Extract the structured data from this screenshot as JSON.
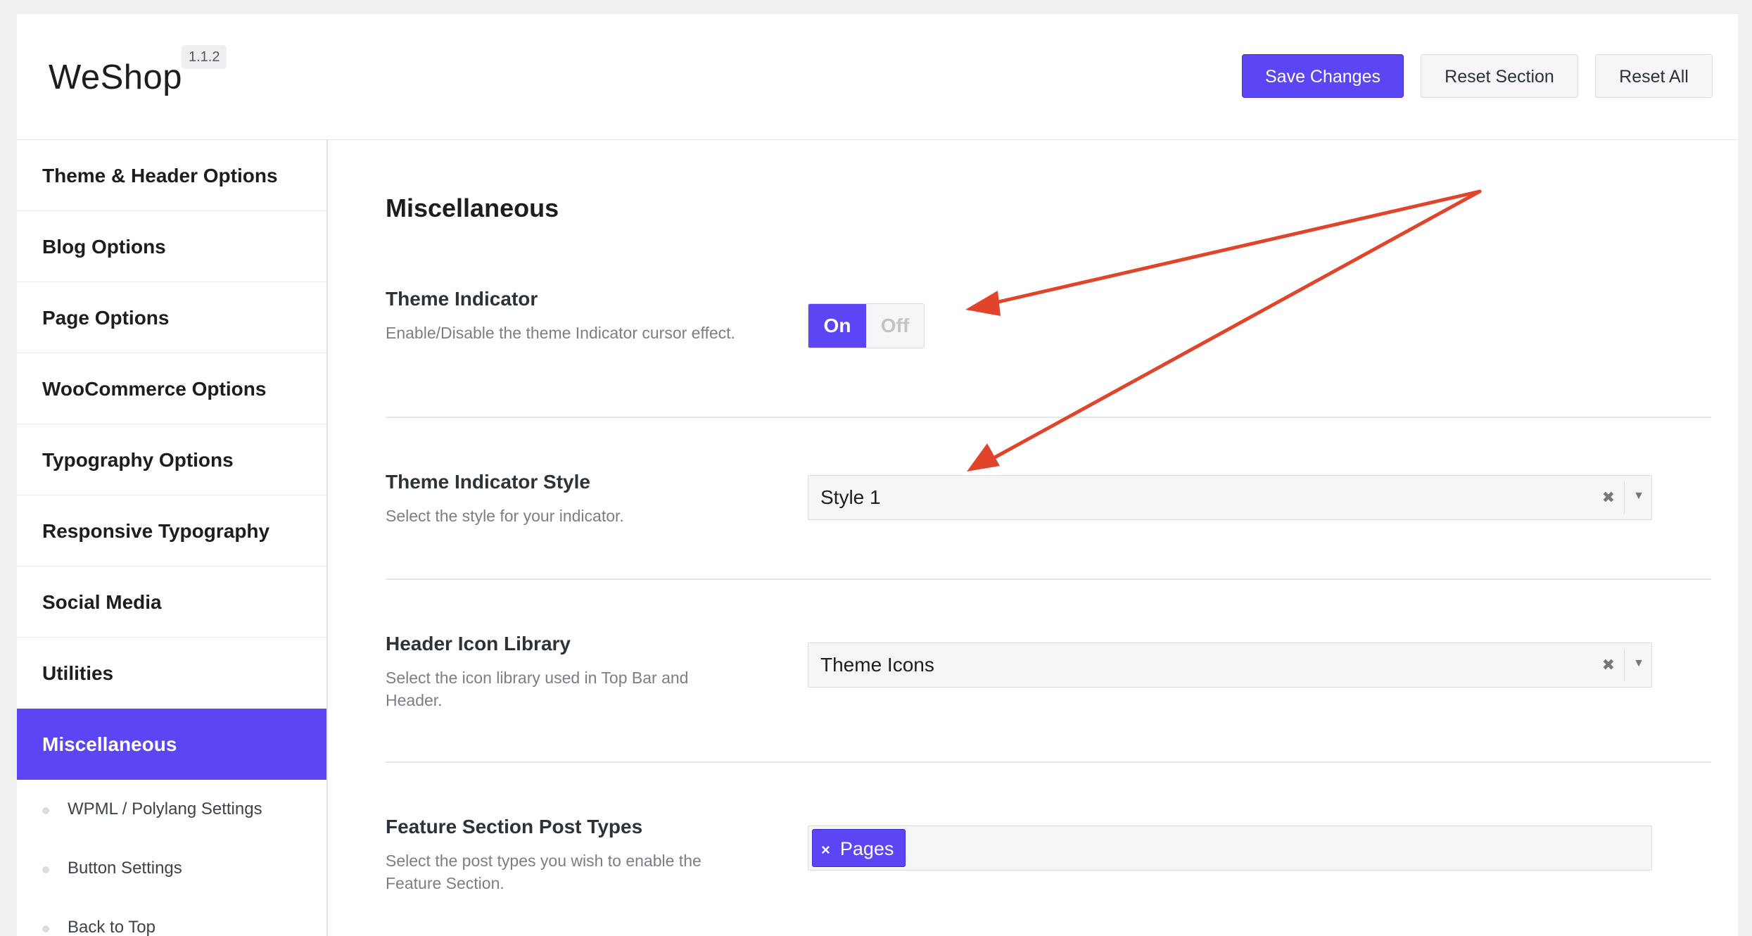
{
  "header": {
    "brand": "WeShop",
    "version": "1.1.2",
    "save_label": "Save Changes",
    "reset_section_label": "Reset Section",
    "reset_all_label": "Reset All"
  },
  "sidebar": {
    "items": [
      {
        "label": "Theme & Header Options"
      },
      {
        "label": "Blog Options"
      },
      {
        "label": "Page Options"
      },
      {
        "label": "WooCommerce Options"
      },
      {
        "label": "Typography Options"
      },
      {
        "label": "Responsive Typography"
      },
      {
        "label": "Social Media"
      },
      {
        "label": "Utilities"
      },
      {
        "label": "Miscellaneous"
      }
    ],
    "subitems": [
      {
        "label": "WPML / Polylang Settings"
      },
      {
        "label": "Button Settings"
      },
      {
        "label": "Back to Top"
      }
    ]
  },
  "main": {
    "title": "Miscellaneous",
    "theme_indicator": {
      "label": "Theme Indicator",
      "desc": "Enable/Disable the theme Indicator cursor effect.",
      "on_label": "On",
      "off_label": "Off"
    },
    "indicator_style": {
      "label": "Theme Indicator Style",
      "desc": "Select the style for your indicator.",
      "value": "Style 1"
    },
    "icon_library": {
      "label": "Header Icon Library",
      "desc": "Select the icon library used in Top Bar and Header.",
      "value": "Theme Icons"
    },
    "post_types": {
      "label": "Feature Section Post Types",
      "desc": "Select the post types you wish to enable the Feature Section.",
      "tag": "Pages"
    }
  },
  "glyphs": {
    "clear": "✖",
    "arrow": "▼",
    "tag_remove": "×"
  },
  "colors": {
    "accent": "#5b45f5",
    "annotation": "#e0452c"
  }
}
